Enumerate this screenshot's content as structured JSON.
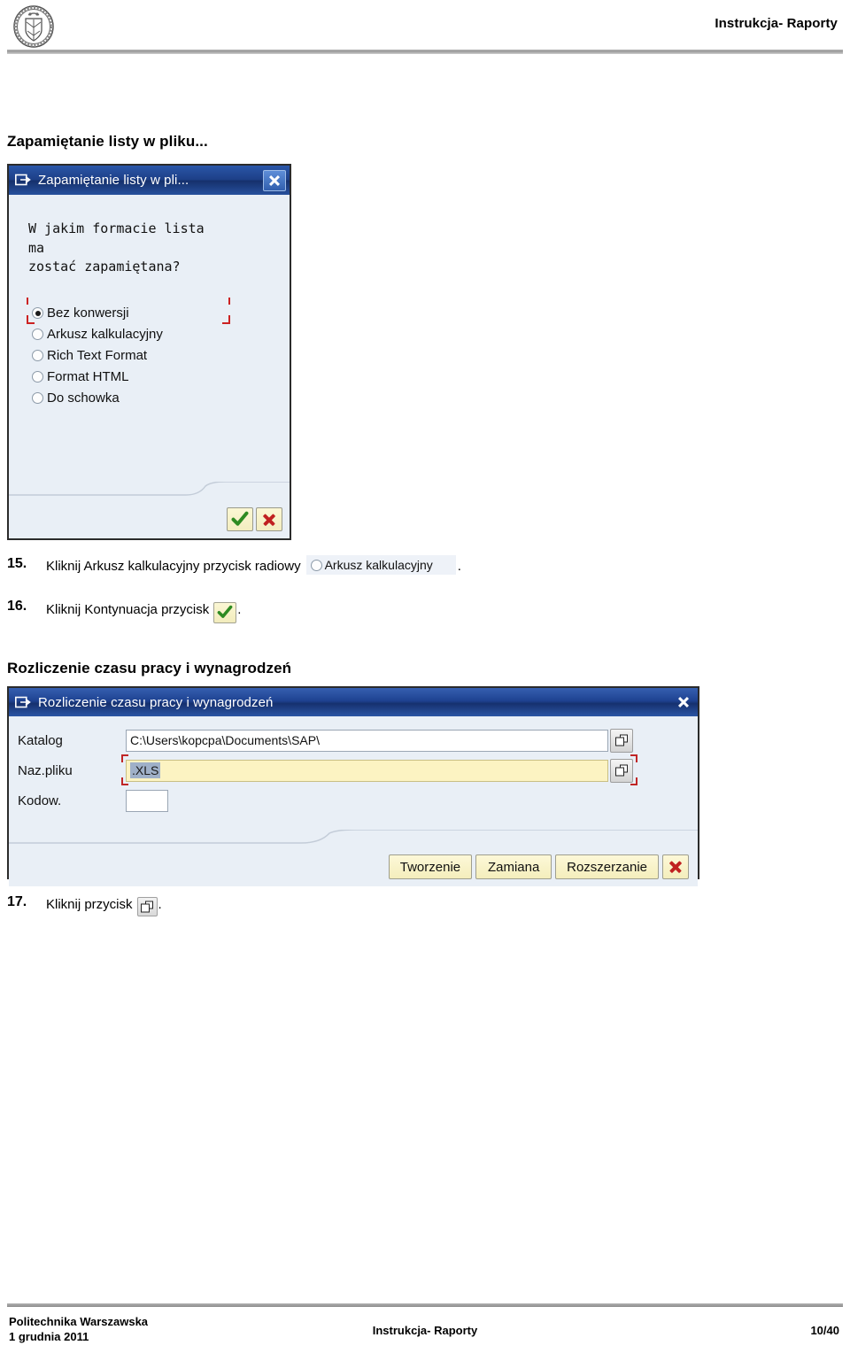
{
  "header": {
    "title": "Instrukcja- Raporty",
    "logo_icon": "university-crest-icon"
  },
  "sections": {
    "save_list_title": "Zapamiętanie listy w pliku...",
    "rozliczenie_title": "Rozliczenie czasu pracy i wynagrodzeń"
  },
  "dialog_save_list": {
    "titlebar": {
      "icon": "sap-window-icon",
      "title": "Zapamiętanie listy w pli...",
      "close_label": "close-icon"
    },
    "question_lines": [
      "W jakim formacie lista",
      "ma",
      "zostać zapamiętana?"
    ],
    "radio_options": [
      {
        "label": "Bez konwersji",
        "selected": true
      },
      {
        "label": "Arkusz kalkulacyjny",
        "selected": false
      },
      {
        "label": "Rich Text Format",
        "selected": false
      },
      {
        "label": "Format HTML",
        "selected": false
      },
      {
        "label": "Do schowka",
        "selected": false
      }
    ],
    "buttons": {
      "confirm": "continue-check-button",
      "cancel": "cancel-x-button"
    }
  },
  "steps": [
    {
      "number": "15.",
      "text_before": "Kliknij Arkusz kalkulacyjny przycisk radiowy",
      "inline_snippet_label": "Arkusz kalkulacyjny",
      "text_after": "."
    },
    {
      "number": "16.",
      "text_before": "Kliknij Kontynuacja przycisk",
      "inline_icon": "green-check-button",
      "text_after": "."
    },
    {
      "number": "17.",
      "text_before": "Kliknij przycisk",
      "inline_icon": "browse-button",
      "text_after": "."
    }
  ],
  "dialog_rozliczenie": {
    "titlebar": {
      "icon": "sap-window-icon",
      "title": "Rozliczenie czasu pracy i wynagrodzeń",
      "close_label": "close-icon"
    },
    "fields": [
      {
        "label": "Katalog",
        "value": "C:\\Users\\kopcpa\\Documents\\SAP\\",
        "has_browse": true
      },
      {
        "label": "Naz.pliku",
        "value": ".XLS",
        "has_browse": true,
        "focused": true
      },
      {
        "label": "Kodow.",
        "value": "",
        "has_browse": false
      }
    ],
    "buttons": [
      {
        "label": "Tworzenie"
      },
      {
        "label": "Zamiana"
      },
      {
        "label": "Rozszerzanie"
      }
    ],
    "cancel_button": "cancel-x-button"
  },
  "footer": {
    "institution": "Politechnika Warszawska",
    "date": "1 grudnia 2011",
    "center": "Instrukcja- Raporty",
    "page": "10/40"
  },
  "colors": {
    "titlebar_blue": "#1d3f87",
    "dialog_bg": "#e9eff6",
    "focus_red": "#c02626",
    "field_yellow": "#fcf3c2",
    "button_yellow": "#fdf8d8"
  }
}
